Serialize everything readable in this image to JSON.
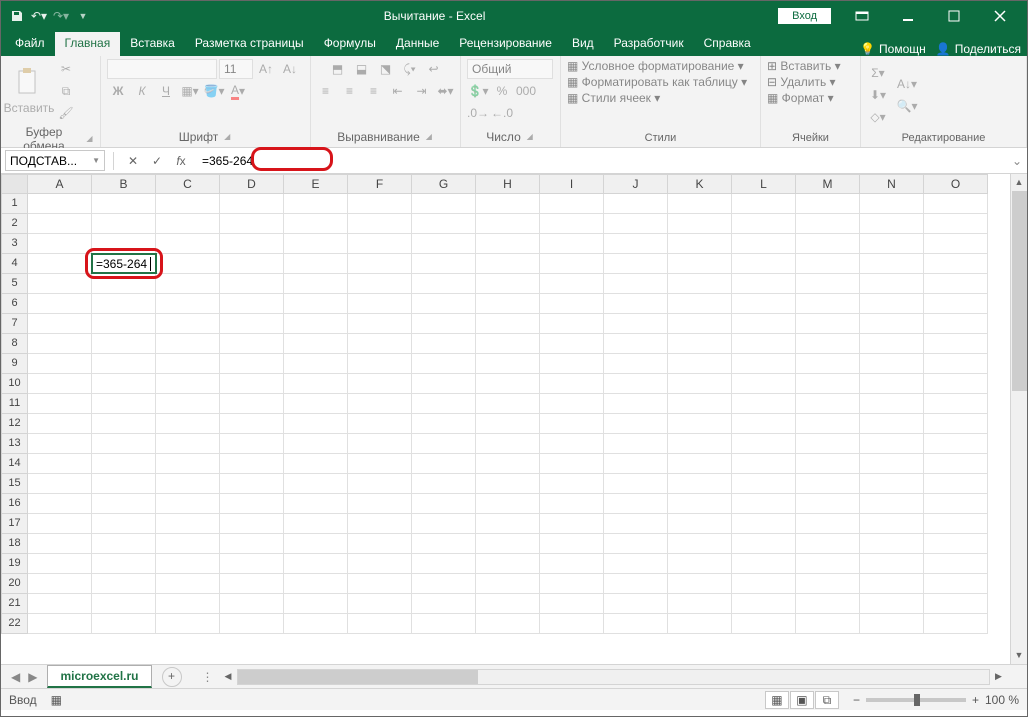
{
  "title": "Вычитание  -  Excel",
  "login": "Вход",
  "tabs": [
    "Файл",
    "Главная",
    "Вставка",
    "Разметка страницы",
    "Формулы",
    "Данные",
    "Рецензирование",
    "Вид",
    "Разработчик",
    "Справка"
  ],
  "active_tab": 1,
  "help_hint": "Помощн",
  "share": "Поделиться",
  "groups": {
    "clipboard": {
      "label": "Буфер обмена",
      "paste": "Вставить"
    },
    "font": {
      "label": "Шрифт",
      "name": "",
      "size": "11"
    },
    "align": {
      "label": "Выравнивание"
    },
    "number": {
      "label": "Число",
      "format": "Общий"
    },
    "styles": {
      "label": "Стили",
      "cond": "Условное форматирование",
      "table": "Форматировать как таблицу",
      "cell": "Стили ячеек"
    },
    "cells": {
      "label": "Ячейки",
      "insert": "Вставить",
      "delete": "Удалить",
      "format": "Формат"
    },
    "editing": {
      "label": "Редактирование"
    }
  },
  "namebox": "ПОДСТАВ...",
  "formula": "=365-264",
  "columns": [
    "A",
    "B",
    "C",
    "D",
    "E",
    "F",
    "G",
    "H",
    "I",
    "J",
    "K",
    "L",
    "M",
    "N",
    "O"
  ],
  "row_count": 22,
  "active_cell": {
    "row": 4,
    "col": "B",
    "value": "=365-264"
  },
  "sheet_tab": "microexcel.ru",
  "status_mode": "Ввод",
  "zoom": "100 %"
}
